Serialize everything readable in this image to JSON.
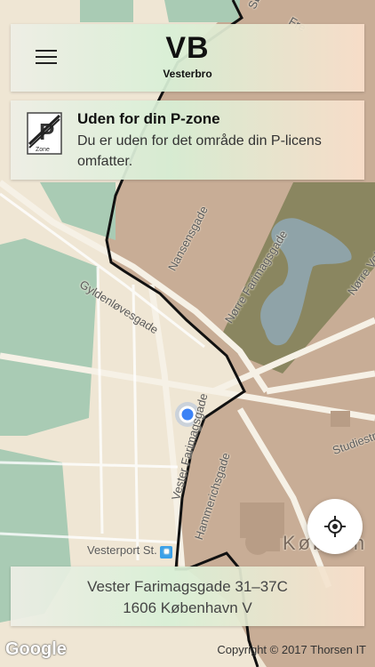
{
  "header": {
    "zone_code": "VB",
    "zone_name": "Vesterbro"
  },
  "notice": {
    "title": "Uden for din P-zone",
    "body": "Du er uden for det område din P-licens omfatter.",
    "icon_label": "Zone"
  },
  "address": {
    "line1": "Vester Farimagsgade 31–37C",
    "line2": "1606 København V"
  },
  "map": {
    "labels": {
      "gyldenlovesgade": "Gyldenløvesgade",
      "nansensgade": "Nansensgade",
      "norre_farimagsgade": "Nørre Farimagsgade",
      "norre_vol": "Nørre Vol",
      "vester_farimagsgade": "Vester Farimagsgade",
      "hammerichsgade": "Hammerichsgade",
      "vesterport": "Vesterport St.",
      "studiestr": "Studiestr",
      "kobenhavn": "Københ",
      "top_so": "Sø",
      "top_fre": "Fre"
    }
  },
  "footer": {
    "google": "Google",
    "copyright": "Copyright © 2017 Thorsen IT"
  },
  "colors": {
    "zone_inside": "#efe6d4",
    "zone_outside": "#c8ad96",
    "park": "#a9cbb4",
    "lake_park": "#8a8660",
    "lake": "#8fa3a8",
    "boundary": "#111111",
    "location_dot": "#3b82f6"
  }
}
